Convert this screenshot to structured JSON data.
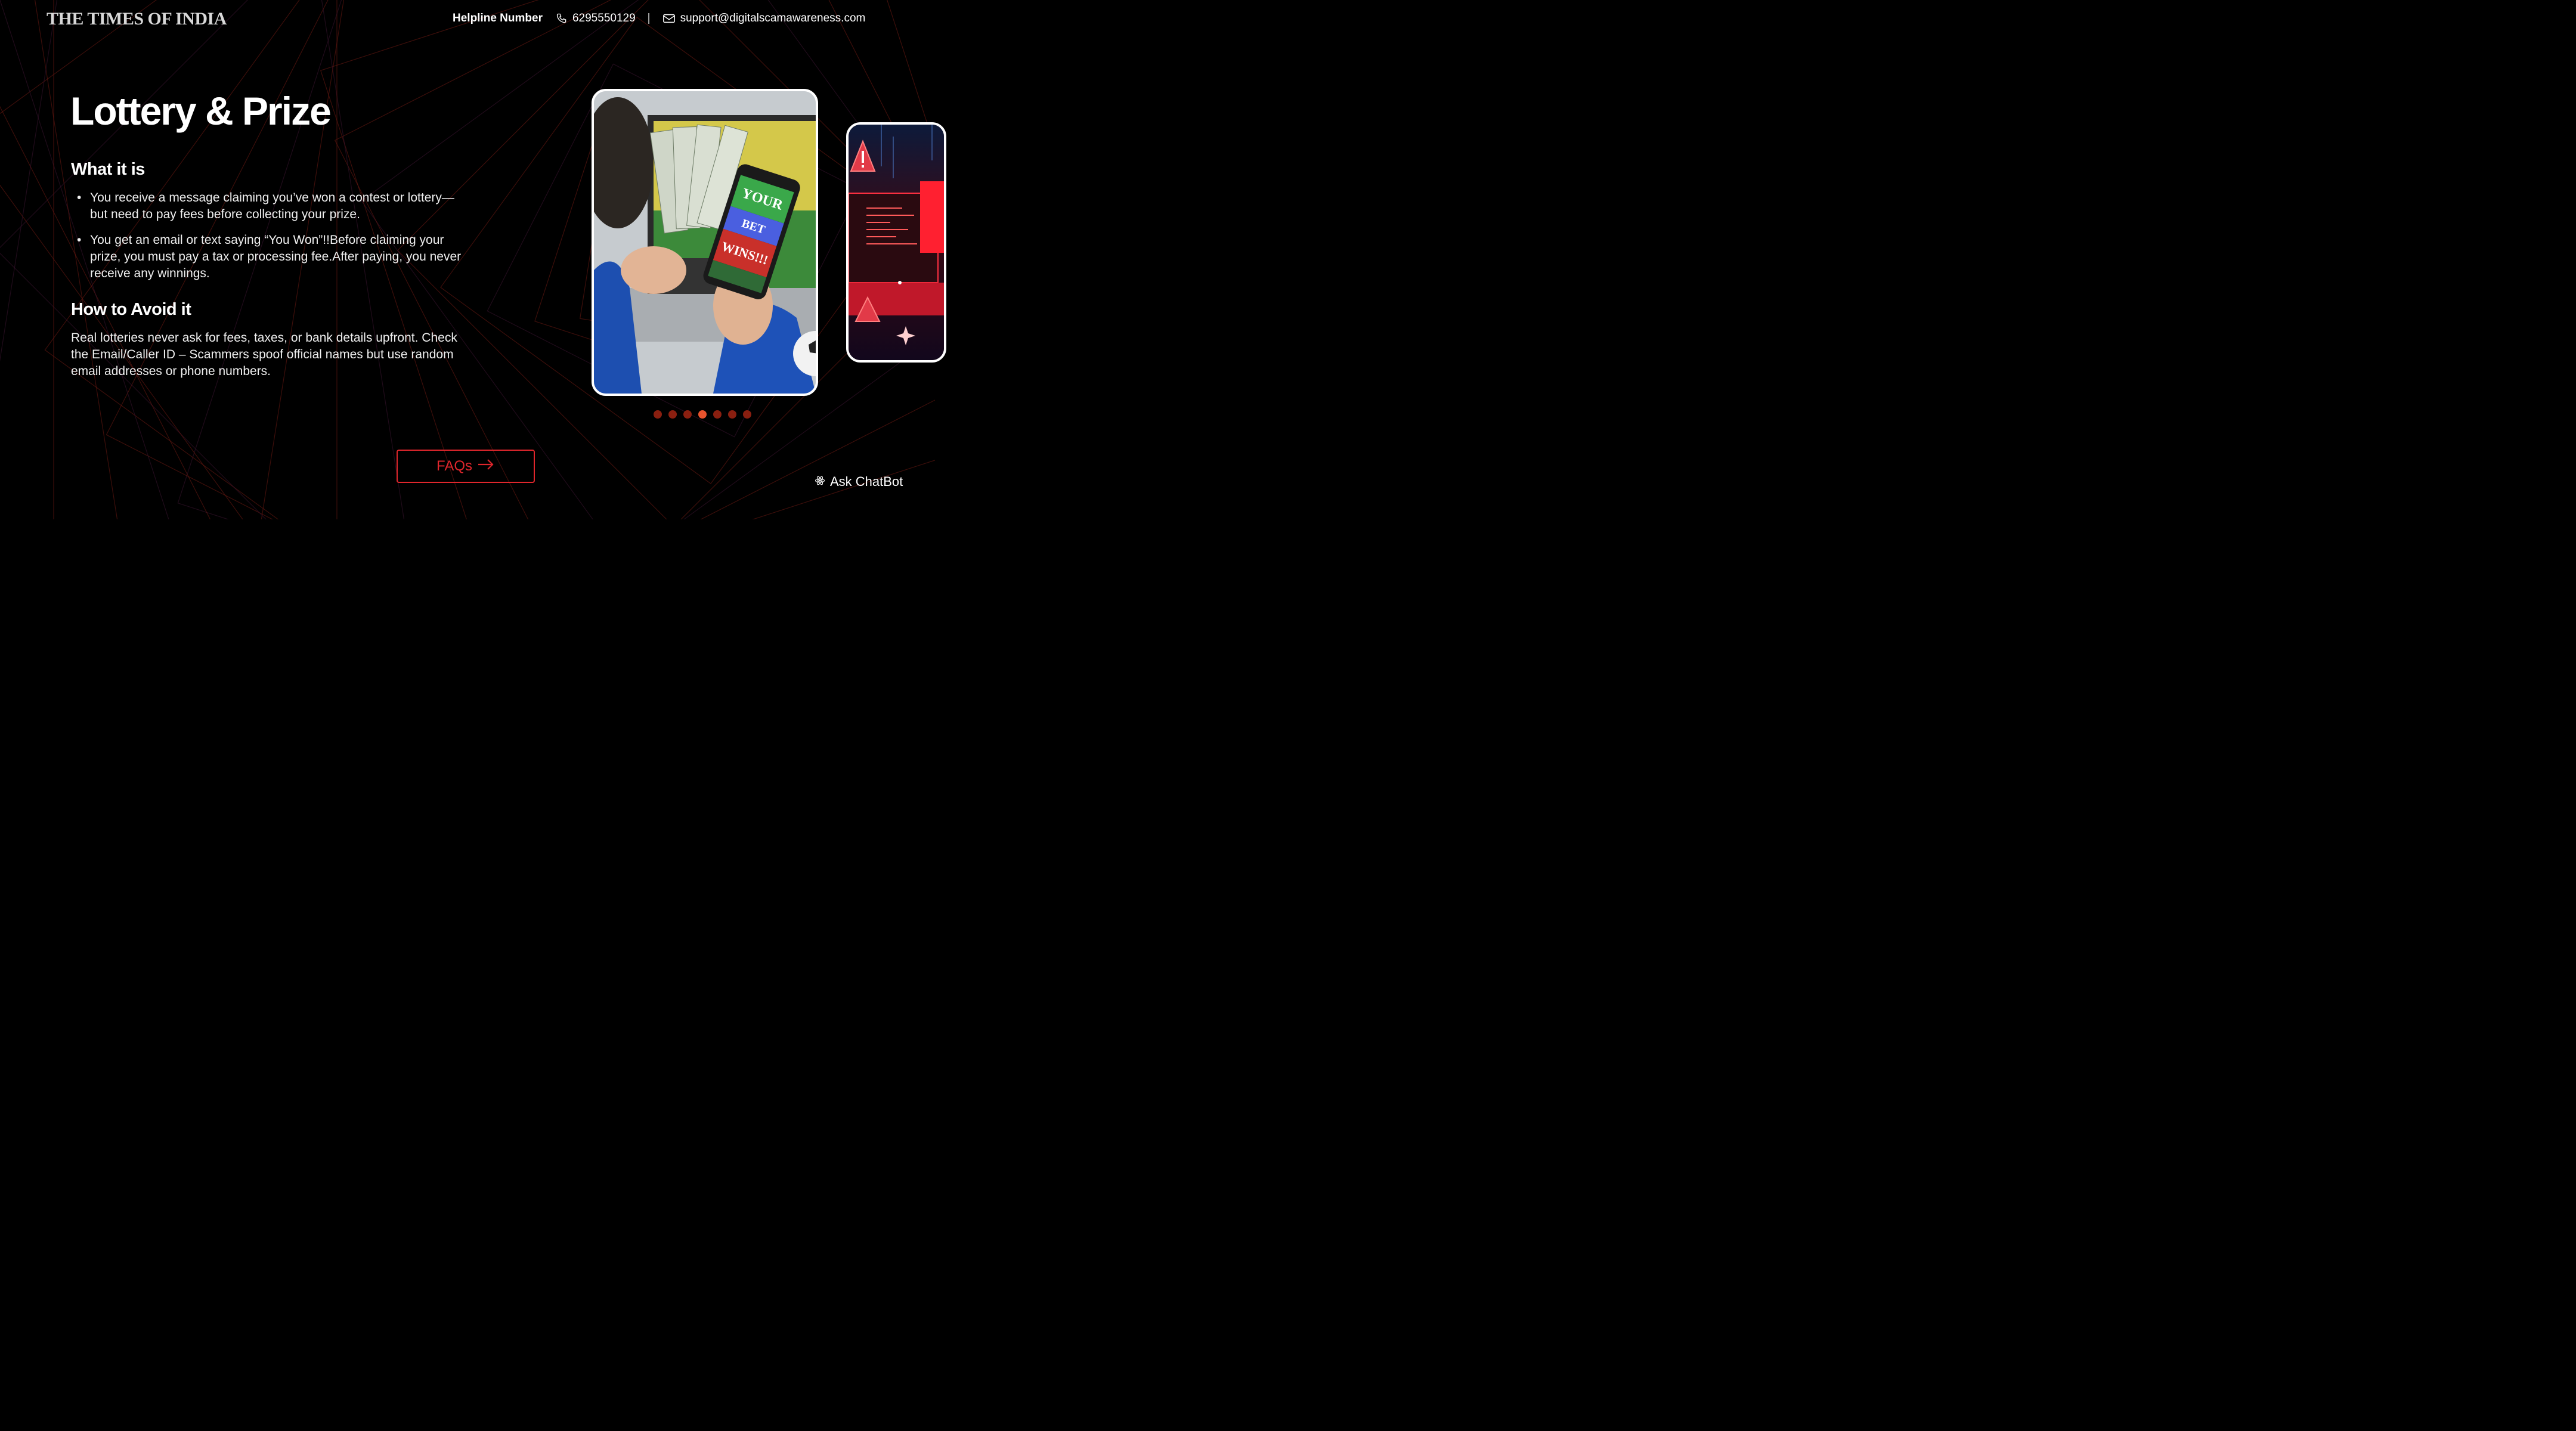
{
  "header": {
    "logo": "THE TIMES OF INDIA",
    "helpline_label": "Helpline Number",
    "phone": "6295550129",
    "separator": "|",
    "email": "support@digitalscamawareness.com"
  },
  "main": {
    "title": "Lottery & Prize",
    "what_heading": "What it is",
    "bullets": [
      "You receive a message claiming you’ve won a contest or lottery—but need to pay fees before collecting your prize.",
      "You get an email or text saying “You Won”!!Before claiming your prize, you must pay a tax or processing fee.After paying, you never receive any winnings."
    ],
    "avoid_heading": "How to Avoid it",
    "avoid_text": "Real lotteries never ask for fees, taxes, or bank details upfront. Check the Email/Caller ID – Scammers spoof official names but use random email addresses or phone numbers."
  },
  "carousel": {
    "phone_screen_text": [
      "YOUR",
      "BET",
      "WINS!!!"
    ],
    "dot_count": 7,
    "active_index": 3
  },
  "buttons": {
    "faqs_label": "FAQs",
    "chatbot_label": "Ask ChatBot"
  },
  "colors": {
    "background": "#000000",
    "accent_red": "#e0262c",
    "dot_inactive": "#8a1f10",
    "dot_active": "#e8532d",
    "line_red": "#6e1a12"
  },
  "icons": {
    "phone": "phone-icon",
    "email": "mail-icon",
    "arrow": "arrow-right-icon",
    "chatbot": "atom-icon"
  }
}
